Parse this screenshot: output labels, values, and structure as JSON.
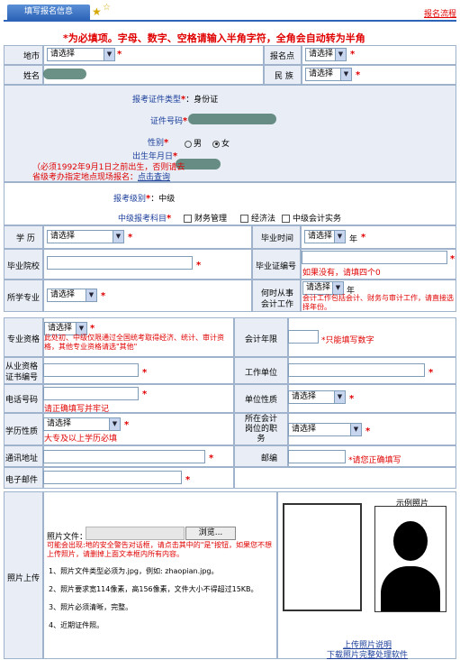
{
  "tab": {
    "label": "填写报名信息"
  },
  "top_link": "报名流程",
  "notice": "*为必填项。字母、数字、空格请输入半角字符，全角会自动转为半角",
  "fields": {
    "region_label": "地市",
    "region_value": "请选择",
    "site_label": "报名点",
    "site_value": "请选择",
    "name_label": "姓名",
    "ethnic_label": "民 族",
    "ethnic_value": "请选择",
    "idtype_label": "报考证件类型",
    "idtype_value": "：身份证",
    "idno_label": "证件号码",
    "gender_label": "性别",
    "gender_male": "男",
    "gender_female": "女",
    "birth_label": "出生年月日",
    "birth_note_1": "（必须1992年9月1日之前出生，否则请去",
    "birth_note_2": "省级考办指定地点现场报名：",
    "birth_note_link": "点击查询",
    "level_label": "报考级别",
    "level_value": "：中级",
    "subject_label": "中级报考科目",
    "subject_opts": [
      "财务管理",
      "经济法",
      "中级会计实务"
    ],
    "edu_label": "学 历",
    "edu_value": "请选择",
    "grad_time_label": "毕业时间",
    "grad_time_value": "请选择",
    "year_unit": "年",
    "school_label": "毕业院校",
    "cert_no_label": "毕业证编号",
    "cert_no_note": "如果没有，请填四个0",
    "major_label": "所学专业",
    "major_value": "请选择",
    "work_start_label_1": "何时从事",
    "work_start_label_2": "会计工作",
    "work_start_value": "请选择",
    "work_start_note": "会计工作包括会计、财务与审计工作，请直接选择年份。",
    "qual_label": "专业资格",
    "qual_value": "请选择",
    "qual_note": "此处初、中级仅限通过全国统考取得经济、统计、审计资格，其他专业资格请选\"其他\"",
    "years_label": "会计年限",
    "years_note": "*只能填写数字",
    "qual_cert_label_1": "从业资格",
    "qual_cert_label_2": "证书编号",
    "employer_label": "工作单位",
    "phone_label": "电话号码",
    "phone_note": "请正确填写并牢记",
    "unit_type_label": "单位性质",
    "unit_type_value": "请选择",
    "edu_nature_label": "学历性质",
    "edu_nature_value": "请选择",
    "edu_nature_note": "大专及以上学历必填",
    "post_label_1": "所在会计",
    "post_label_2": "岗位的职",
    "post_label_3": "务",
    "post_value": "请选择",
    "address_label": "通讯地址",
    "zip_label": "邮编",
    "zip_note": "*请您正确填写",
    "email_label": "电子邮件"
  },
  "photo": {
    "section_label": "照片上传",
    "file_label": "照片文件：",
    "browse_label": "浏览...",
    "warn": "可能会出现:地的安全警告对话框，请点击其中的\"是\"按钮，如果您不想上传照片，请删掉上面文本框内所有内容。",
    "rules": [
      "1、照片文件类型必须为.jpg，例如: zhaopian.jpg。",
      "2、照片要求宽114像素，高156像素，文件大小不得超过15KB。",
      "3、照片必须清晰，完整。",
      "4、近期证件照。"
    ],
    "sample_label": "示例照片",
    "link_1": "上传照片说明",
    "link_2": "下载照片完整处理软件"
  }
}
